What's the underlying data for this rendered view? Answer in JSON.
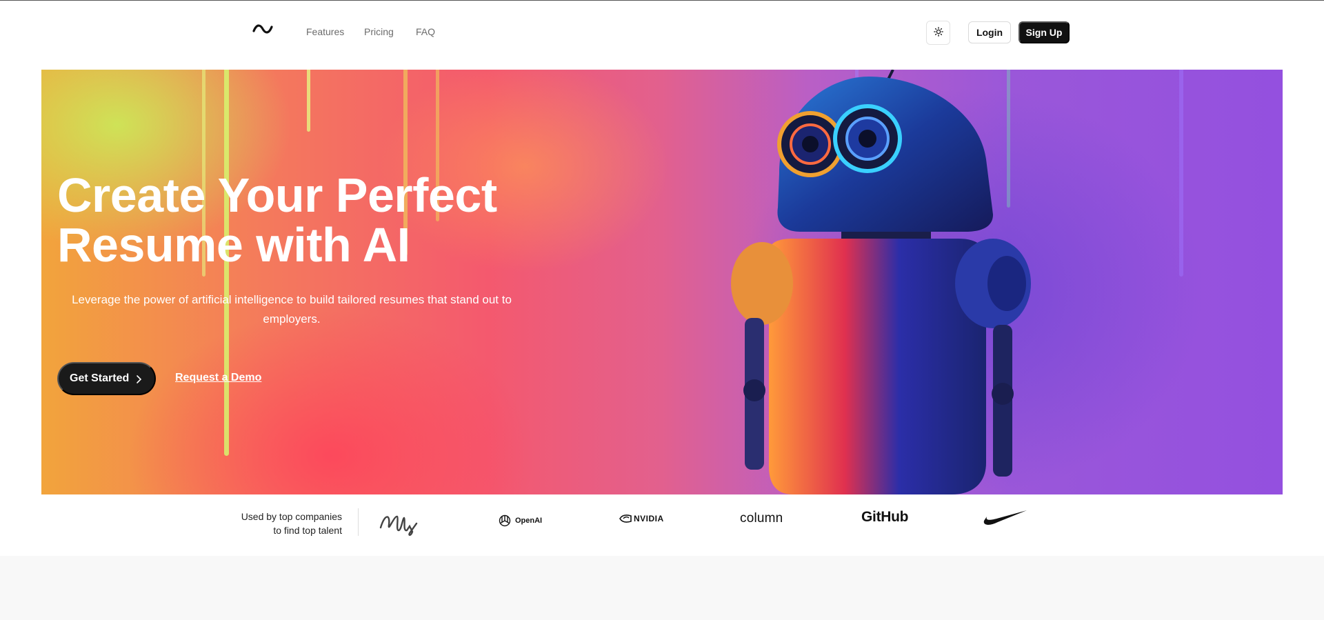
{
  "header": {
    "logo_icon": "tilde-logo-icon",
    "nav": [
      {
        "label": "Features"
      },
      {
        "label": "Pricing"
      },
      {
        "label": "FAQ"
      }
    ],
    "theme_toggle_icon": "sun-icon",
    "login_label": "Login",
    "signup_label": "Sign Up"
  },
  "hero": {
    "title_line1": "Create Your Perfect",
    "title_line2": "Resume with AI",
    "subtitle": "Leverage the power of artificial intelligence to build tailored resumes that stand out to employers.",
    "primary_cta": "Get Started",
    "secondary_cta": "Request a Demo",
    "image": "robot-painting-illustration"
  },
  "logos": {
    "caption_line1": "Used by top companies",
    "caption_line2": "to find top talent",
    "items": [
      {
        "name": "signature-logo",
        "text": "elly"
      },
      {
        "name": "openai-logo",
        "text": "OpenAI"
      },
      {
        "name": "nvidia-logo",
        "text": "NVIDIA"
      },
      {
        "name": "column-logo",
        "text": "column"
      },
      {
        "name": "github-logo",
        "text": "GitHub"
      },
      {
        "name": "nike-logo",
        "text": ""
      }
    ]
  },
  "colors": {
    "primary": "#111111",
    "hero_gradient_start": "#f2a43c",
    "hero_gradient_mid": "#f4596e",
    "hero_gradient_end": "#9450df"
  }
}
